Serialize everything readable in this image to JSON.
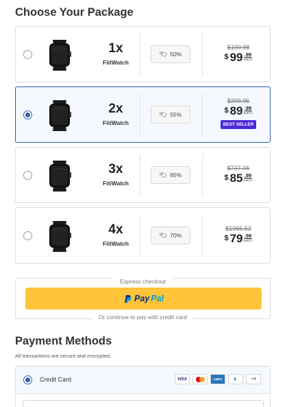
{
  "package_section": {
    "title": "Choose Your Package"
  },
  "packages": [
    {
      "qty": "1x",
      "product": "FitiWatch",
      "discount": "50%",
      "old_price": "$199.98",
      "currency": "$",
      "price_whole": "99",
      "price_cents": ".99",
      "each": "each",
      "badge": "",
      "selected": false
    },
    {
      "qty": "2x",
      "product": "FitiWatch",
      "discount": "55%",
      "old_price": "$399.96",
      "currency": "$",
      "price_whole": "89",
      "price_cents": ".99",
      "each": "each",
      "badge": "BEST SELLER",
      "selected": true
    },
    {
      "qty": "3x",
      "product": "FitiWatch",
      "discount": "65%",
      "old_price": "$737.06",
      "currency": "$",
      "price_whole": "85",
      "price_cents": ".99",
      "each": "each",
      "badge": "",
      "selected": false
    },
    {
      "qty": "4x",
      "product": "FitiWatch",
      "discount": "70%",
      "old_price": "$1066.53",
      "currency": "$",
      "price_whole": "79",
      "price_cents": ".99",
      "each": "each",
      "badge": "",
      "selected": false
    }
  ],
  "express": {
    "label": "Express checkout",
    "paypal_part1": "Pay",
    "paypal_part2": "Pal",
    "continue_label": "Or continue to pay with credit card"
  },
  "payment": {
    "title": "Payment Methods",
    "note": "All transactions are secure and encrypted.",
    "method_label": "Credit Card",
    "cards": [
      "VISA",
      "mastercard",
      "AMEX",
      "diners",
      "+4"
    ],
    "more_cards": "+4",
    "visa": "VISA",
    "amex": "AMEX"
  },
  "colors": {
    "selected_border": "#2f5fa8",
    "paypal_bg": "#ffc439",
    "badge_bg": "#4a2ad6"
  }
}
